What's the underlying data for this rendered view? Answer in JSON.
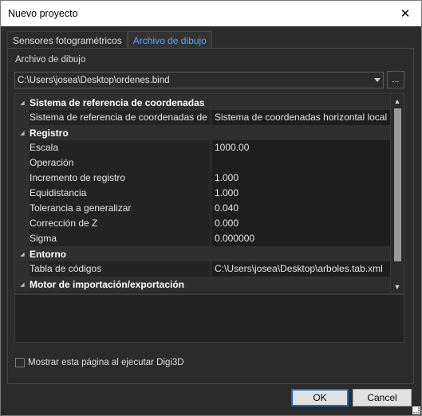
{
  "window": {
    "title": "Nuevo proyecto",
    "close_glyph": "✕"
  },
  "tabs": [
    {
      "label": "Sensores fotogramétricos",
      "active": false
    },
    {
      "label": "Archivo de dibujo",
      "active": true
    }
  ],
  "file": {
    "label": "Archivo de dibujo",
    "value": "C:\\Users\\josea\\Desktop\\ordenes.bind",
    "browse_label": "..."
  },
  "property_grid": {
    "rows": [
      {
        "type": "category",
        "label": "Sistema de referencia de coordenadas"
      },
      {
        "type": "prop",
        "name": "Sistema de referencia de coordenadas de la",
        "value": "Sistema de coordenadas horizontal local + "
      },
      {
        "type": "category",
        "label": "Registro"
      },
      {
        "type": "prop",
        "name": "Escala",
        "value": "1000.00"
      },
      {
        "type": "prop",
        "name": "Operación",
        "value": ""
      },
      {
        "type": "prop",
        "name": "Incremento de registro",
        "value": "1.000"
      },
      {
        "type": "prop",
        "name": "Equidistancia",
        "value": "1.000"
      },
      {
        "type": "prop",
        "name": "Tolerancia a generalizar",
        "value": "0.040"
      },
      {
        "type": "prop",
        "name": "Corrección de Z",
        "value": "0.000"
      },
      {
        "type": "prop",
        "name": "Sigma",
        "value": "0.000000"
      },
      {
        "type": "category",
        "label": "Entorno"
      },
      {
        "type": "prop",
        "name": "Tabla de códigos",
        "value": "C:\\Users\\josea\\Desktop\\arboles.tab.xml"
      },
      {
        "type": "category",
        "label": "Motor de importación/exportación"
      }
    ]
  },
  "footer": {
    "checkbox_label": "Mostrar esta página al ejecutar Digi3D",
    "checked": false,
    "ok_label": "OK",
    "cancel_label": "Cancel"
  },
  "colors": {
    "accent": "#4aa8ff",
    "background": "#2b2b2b",
    "ok_border": "#0a6fd6"
  }
}
